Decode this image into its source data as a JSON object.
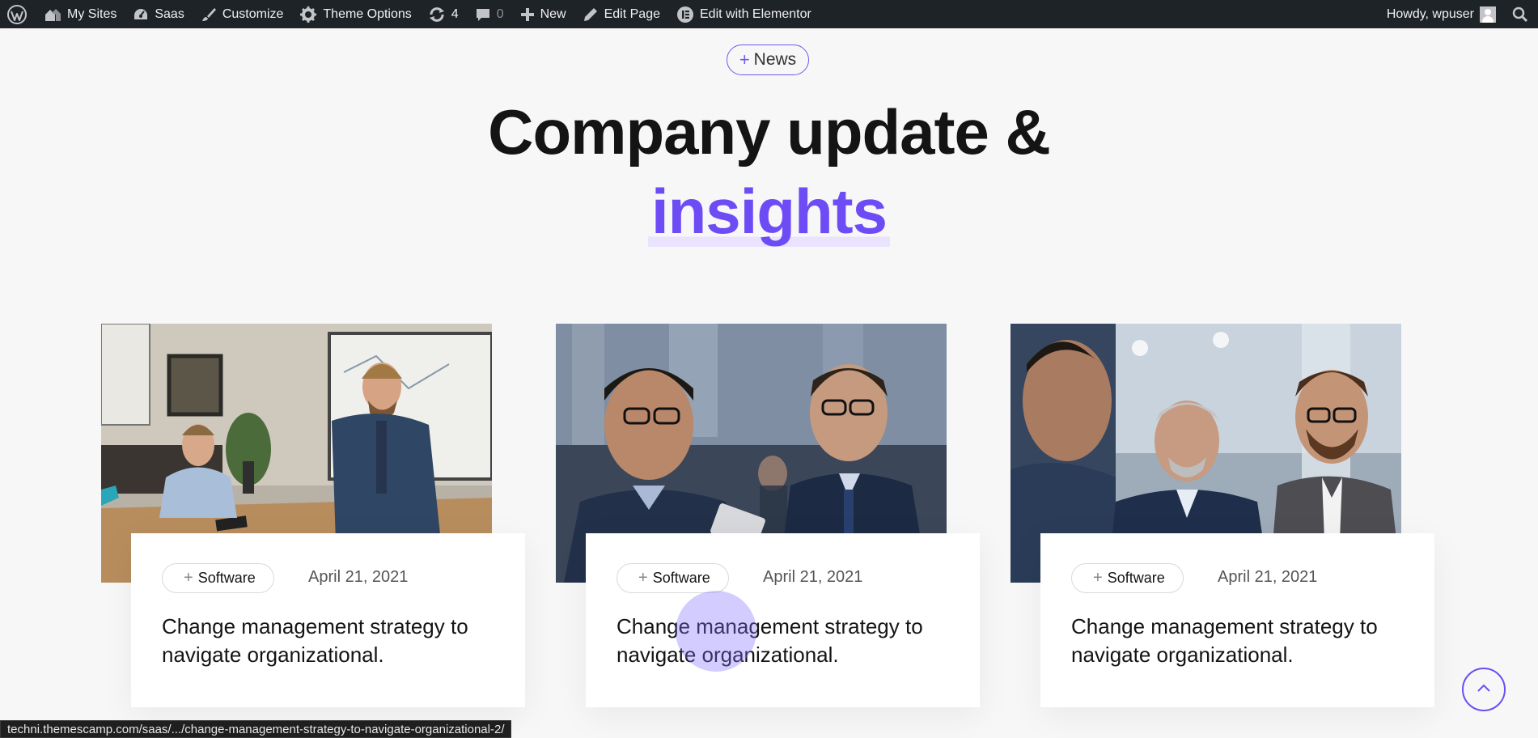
{
  "admin_bar": {
    "my_sites": "My Sites",
    "site_name": "Saas",
    "customize": "Customize",
    "theme_options": "Theme Options",
    "updates_count": "4",
    "comments_count": "0",
    "new": "New",
    "edit_page": "Edit Page",
    "edit_elementor": "Edit with Elementor",
    "howdy": "Howdy, wpuser"
  },
  "section": {
    "pill_label": "News",
    "title_line1": "Company update &",
    "title_highlight": "insights"
  },
  "posts": [
    {
      "category": "Software",
      "date": "April 21, 2021",
      "title": "Change management strategy to navigate organizational."
    },
    {
      "category": "Software",
      "date": "April 21, 2021",
      "title": "Change management strategy to navigate organizational."
    },
    {
      "category": "Software",
      "date": "April 21, 2021",
      "title": "Change management strategy to navigate organizational."
    }
  ],
  "status_bar": {
    "url": "techni.themescamp.com/saas/.../change-management-strategy-to-navigate-organizational-2/"
  },
  "colors": {
    "accent": "#6d4cf6",
    "admin_bar_bg": "#1d2327",
    "page_bg": "#f7f7f7"
  },
  "icons": [
    "wordpress-icon",
    "my-sites-icon",
    "dashboard-icon",
    "brush-icon",
    "gear-icon",
    "updates-icon",
    "comment-icon",
    "plus-icon",
    "pencil-icon",
    "elementor-icon",
    "avatar",
    "search-icon",
    "chevron-up-icon"
  ]
}
